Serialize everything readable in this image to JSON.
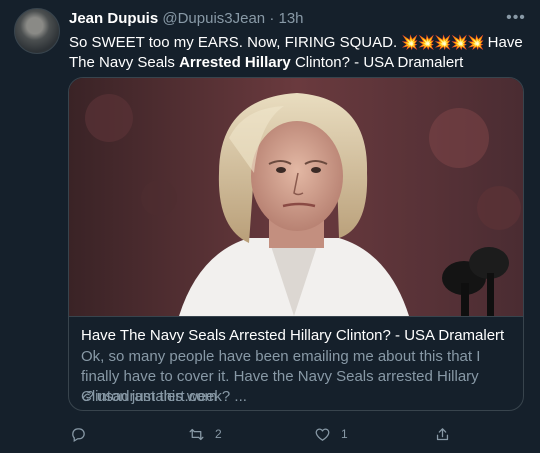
{
  "tweet": {
    "display_name": "Jean Dupuis",
    "handle": "@Dupuis3Jean",
    "separator": "·",
    "time": "13h",
    "text_part1": "So SWEET too my EARS. Now, FIRING SQUAD.",
    "emojis": "💥💥💥💥💥",
    "text_part2": "Have The Navy Seals",
    "text_bold": "Arrested Hillary",
    "text_part3": "Clinton? - USA Dramalert"
  },
  "card": {
    "title": "Have The Navy Seals Arrested Hillary Clinton? - USA Dramalert",
    "description": "Ok, so many people have been emailing me about this that I finally have to cover it. Have the Navy Seals arrested Hillary Clinton just this week? ...",
    "domain": "usadramalert.com"
  },
  "actions": {
    "reply_count": "",
    "retweet_count": "2",
    "like_count": "1"
  },
  "icons": {
    "more": "more-icon",
    "reply": "reply-icon",
    "retweet": "retweet-icon",
    "like": "like-icon",
    "share": "share-icon",
    "link": "link-icon"
  },
  "colors": {
    "background": "#15202b",
    "border": "#38444d",
    "secondary_text": "#8899a6",
    "primary_text": "#ffffff"
  }
}
